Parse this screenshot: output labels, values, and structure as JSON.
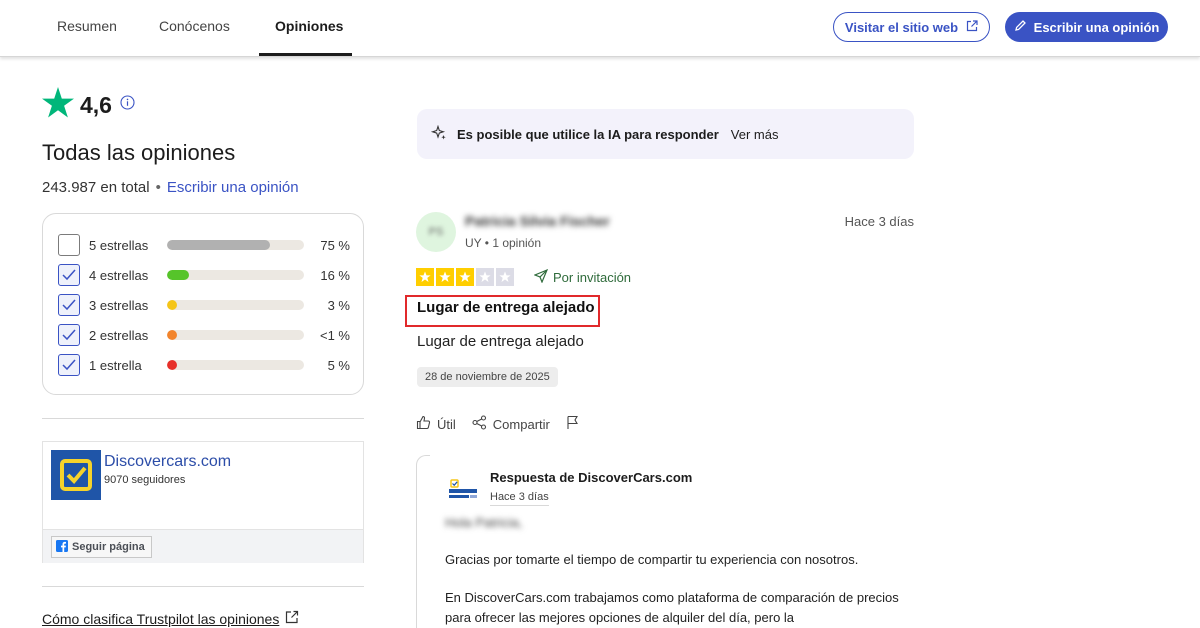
{
  "nav": {
    "tabs": [
      {
        "label": "Resumen"
      },
      {
        "label": "Conócenos"
      },
      {
        "label": "Opiniones"
      }
    ],
    "visit_site_label": "Visitar el sitio web",
    "write_review_label": "Escribir una opinión"
  },
  "summary": {
    "rating": "4,6",
    "title": "Todas las opiniones",
    "total": "243.987 en total",
    "write_link": "Escribir una opinión",
    "distribution": [
      {
        "label": "5 estrellas",
        "percent": "75 %",
        "fill": 0.75,
        "color": "#b1b1b1",
        "checked": false
      },
      {
        "label": "4 estrellas",
        "percent": "16 %",
        "fill": 0.16,
        "color": "#56c42a",
        "checked": true
      },
      {
        "label": "3 estrellas",
        "percent": "3 %",
        "fill": 0.03,
        "color": "#f5c518",
        "checked": true
      },
      {
        "label": "2 estrellas",
        "percent": "<1 %",
        "fill": 0.01,
        "color": "#f2842c",
        "checked": true
      },
      {
        "label": "1 estrella",
        "percent": "5 %",
        "fill": 0.05,
        "color": "#e7302a",
        "checked": true
      }
    ]
  },
  "facebook": {
    "page_name": "Discovercars.com",
    "followers": "9070 seguidores",
    "follow_button": "Seguir página"
  },
  "how_link": "Cómo clasifica Trustpilot las opiniones",
  "ai_banner": {
    "text": "Es posible que utilice la IA para responder",
    "more": "Ver más"
  },
  "review": {
    "avatar_initials": "PS",
    "reviewer_name": "Patricia Silvia Fischer",
    "reviewer_meta": "UY • 1 opinión",
    "date_top": "Hace 3 días",
    "stars": 3,
    "invited": "Por invitación",
    "title": "Lugar de entrega alejado",
    "body": "Lugar de entrega alejado",
    "date_chip": "28 de noviembre de 2025",
    "useful": "Útil",
    "share": "Compartir"
  },
  "reply": {
    "by": "Respuesta de DiscoverCars.com",
    "date": "Hace 3 días",
    "greeting": "Hola Patricia,",
    "p1": "Gracias por tomarte el tiempo de compartir tu experiencia con nosotros.",
    "p2": "En DiscoverCars.com trabajamos como plataforma de comparación de precios para ofrecer las mejores opciones de alquiler del día, pero la"
  },
  "colors": {
    "brand_blue": "#3a53c4",
    "trust_green": "#00b67a",
    "star_yellow": "#ffce00"
  }
}
